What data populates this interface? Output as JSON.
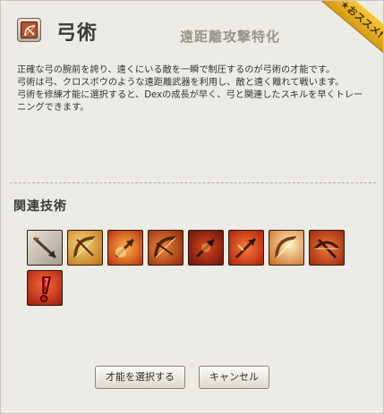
{
  "header": {
    "class_icon": "bow-class-icon",
    "class_name": "弓術",
    "subtitle": "遠距離攻撃特化",
    "ribbon": "★おススメ!"
  },
  "description": "正確な弓の腕前を誇り、遠くにいる敵を一瞬で制圧するのが弓術の才能です。\n弓術は弓、クロスボウのような遠距離武器を利用し、敵と遠く離れて戦います。\n弓術を修練才能に選択すると、Dexの成長が早く、弓と関連したスキルを早くトレーニングできます。",
  "related_skills": {
    "title": "関連技術",
    "icons": [
      {
        "name": "arrow-shot-icon",
        "bg": "#c9c3b6"
      },
      {
        "name": "golden-bow-icon",
        "bg": "#d89a2a"
      },
      {
        "name": "fire-arrow-icon",
        "bg": "#d4541a"
      },
      {
        "name": "flame-bow-icon",
        "bg": "#c5461c"
      },
      {
        "name": "burning-arrow-icon",
        "bg": "#b8321a"
      },
      {
        "name": "piercing-arrow-icon",
        "bg": "#d63a1e"
      },
      {
        "name": "bright-bow-icon",
        "bg": "#e39a3a"
      },
      {
        "name": "crossbow-icon",
        "bg": "#c9461c"
      },
      {
        "name": "exclamation-icon",
        "bg": "#c63418"
      }
    ]
  },
  "buttons": {
    "select": "才能を選択する",
    "cancel": "キャンセル"
  }
}
